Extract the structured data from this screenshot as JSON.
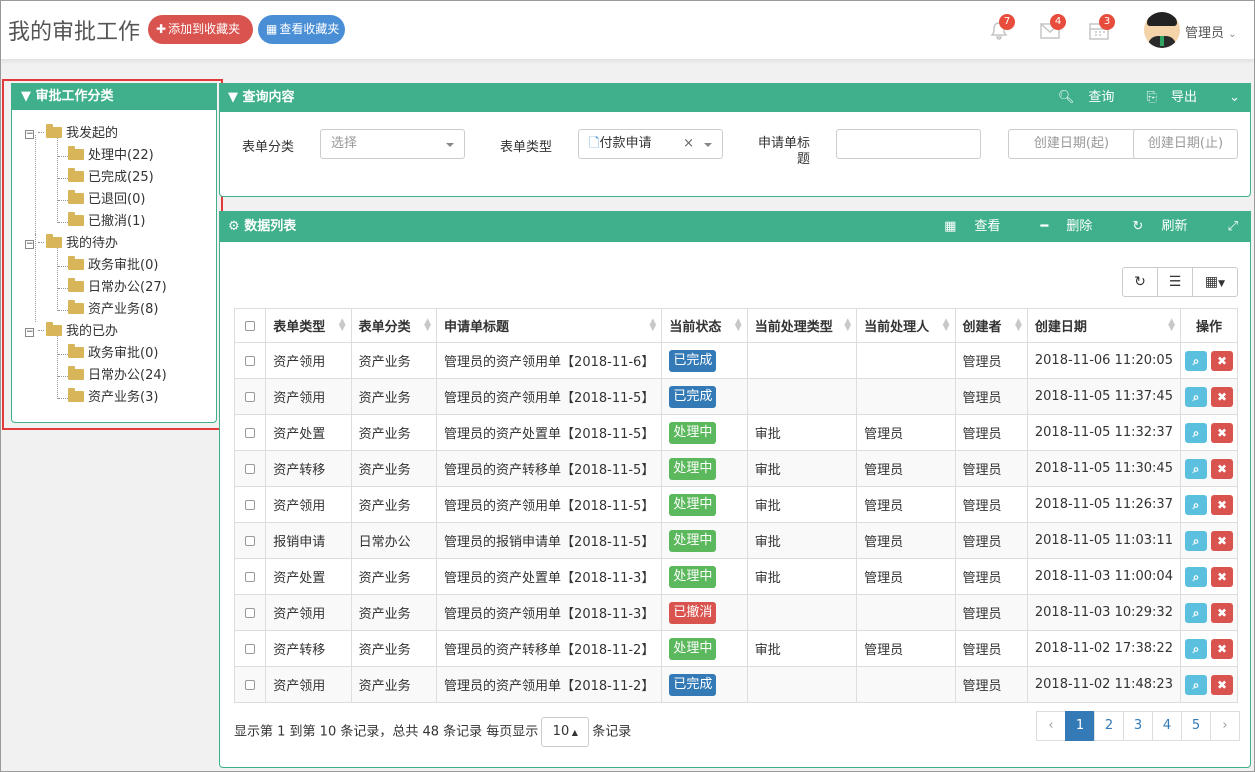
{
  "header": {
    "title": "我的审批工作",
    "add_fav": "添加到收藏夹",
    "view_fav": "查看收藏夹",
    "notif_count": "7",
    "mail_count": "4",
    "task_count": "3",
    "username": "管理员"
  },
  "left": {
    "title": "审批工作分类",
    "groups": [
      {
        "label": "我发起的",
        "items": [
          "处理中(22)",
          "已完成(25)",
          "已退回(0)",
          "已撤消(1)"
        ]
      },
      {
        "label": "我的待办",
        "items": [
          "政务审批(0)",
          "日常办公(27)",
          "资产业务(8)"
        ]
      },
      {
        "label": "我的已办",
        "items": [
          "政务审批(0)",
          "日常办公(24)",
          "资产业务(3)"
        ]
      }
    ]
  },
  "query": {
    "title": "查询内容",
    "search": "查询",
    "export": "导出",
    "form_category_label": "表单分类",
    "form_category_placeholder": "选择",
    "form_type_label": "表单类型",
    "form_type_value": "付款申请",
    "form_type_clear": "×",
    "title_label_1": "申请单标",
    "title_label_2": "题",
    "date_start": "创建日期(起)",
    "date_sep": "-",
    "date_end": "创建日期(止)"
  },
  "data": {
    "title": "数据列表",
    "view": "查看",
    "delete": "删除",
    "refresh": "刷新",
    "columns": [
      "表单类型",
      "表单分类",
      "申请单标题",
      "当前状态",
      "当前处理类型",
      "当前处理人",
      "创建者",
      "创建日期",
      "操作"
    ],
    "rows": [
      [
        "资产领用",
        "资产业务",
        "管理员的资产领用单【2018-11-6】",
        "已完成",
        "",
        "",
        "管理员",
        "2018-11-06 11:20:05"
      ],
      [
        "资产领用",
        "资产业务",
        "管理员的资产领用单【2018-11-5】",
        "已完成",
        "",
        "",
        "管理员",
        "2018-11-05 11:37:45"
      ],
      [
        "资产处置",
        "资产业务",
        "管理员的资产处置单【2018-11-5】",
        "处理中",
        "审批",
        "管理员",
        "管理员",
        "2018-11-05 11:32:37"
      ],
      [
        "资产转移",
        "资产业务",
        "管理员的资产转移单【2018-11-5】",
        "处理中",
        "审批",
        "管理员",
        "管理员",
        "2018-11-05 11:30:45"
      ],
      [
        "资产领用",
        "资产业务",
        "管理员的资产领用单【2018-11-5】",
        "处理中",
        "审批",
        "管理员",
        "管理员",
        "2018-11-05 11:26:37"
      ],
      [
        "报销申请",
        "日常办公",
        "管理员的报销申请单【2018-11-5】",
        "处理中",
        "审批",
        "管理员",
        "管理员",
        "2018-11-05 11:03:11"
      ],
      [
        "资产处置",
        "资产业务",
        "管理员的资产处置单【2018-11-3】",
        "处理中",
        "审批",
        "管理员",
        "管理员",
        "2018-11-03 11:00:04"
      ],
      [
        "资产领用",
        "资产业务",
        "管理员的资产领用单【2018-11-3】",
        "已撤消",
        "",
        "",
        "管理员",
        "2018-11-03 10:29:32"
      ],
      [
        "资产转移",
        "资产业务",
        "管理员的资产转移单【2018-11-2】",
        "处理中",
        "审批",
        "管理员",
        "管理员",
        "2018-11-02 17:38:22"
      ],
      [
        "资产领用",
        "资产业务",
        "管理员的资产领用单【2018-11-2】",
        "已完成",
        "",
        "",
        "管理员",
        "2018-11-02 11:48:23"
      ]
    ],
    "footer_prefix": "显示第 1 到第 10 条记录，总共 48 条记录 每页显示",
    "page_size": "10",
    "footer_suffix": "条记录",
    "pages": [
      "‹",
      "1",
      "2",
      "3",
      "4",
      "5",
      "›"
    ],
    "active_page": "1",
    "status_colors": {
      "已完成": "#337ab7",
      "处理中": "#5cb85c",
      "已撤消": "#d9534f"
    }
  }
}
